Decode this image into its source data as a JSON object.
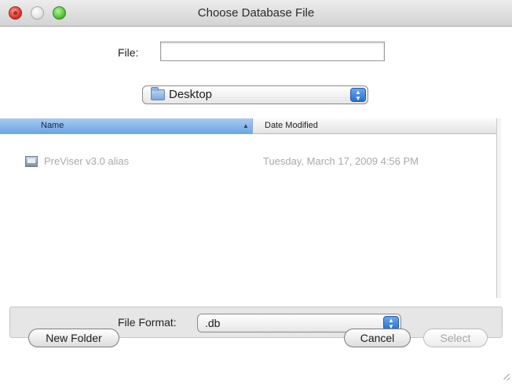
{
  "window": {
    "title": "Choose Database File"
  },
  "file": {
    "label": "File:",
    "value": ""
  },
  "location": {
    "label": "Desktop"
  },
  "columns": {
    "name": "Name",
    "date": "Date Modified"
  },
  "rows": [
    {
      "name": "PreViser v3.0 alias",
      "date": "Tuesday, March 17, 2009 4:56 PM"
    }
  ],
  "format": {
    "label": "File Format:",
    "value": ".db"
  },
  "buttons": {
    "new_folder": "New Folder",
    "cancel": "Cancel",
    "select": "Select"
  },
  "icons": {
    "location": "folder-icon",
    "row_0": "alias-icon",
    "sort": "sort-ascending-icon"
  },
  "colors": {
    "selected_column": "#6aa3e5",
    "close": "#e0342a",
    "maximize": "#58c33a",
    "stepper": "#2a6fd1"
  }
}
